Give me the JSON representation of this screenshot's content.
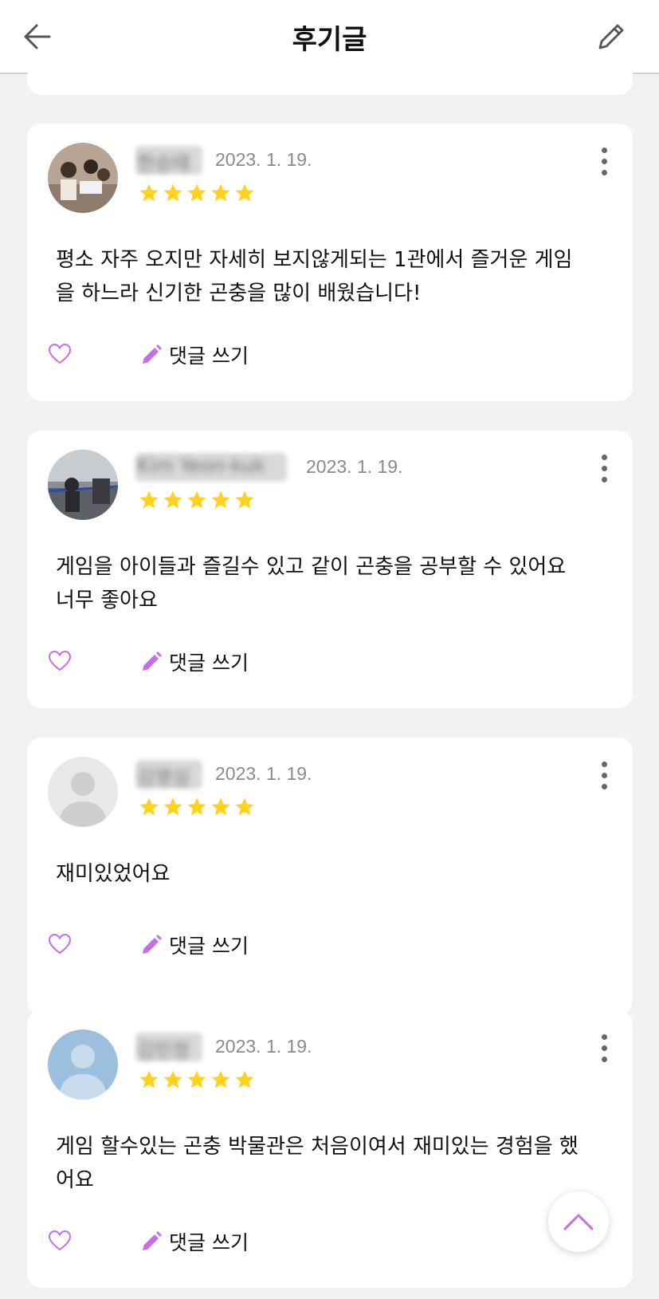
{
  "header": {
    "title": "후기글",
    "back_icon": "back-arrow-icon",
    "edit_icon": "pencil-icon"
  },
  "colors": {
    "star": "#FFD21F",
    "accent": "#C96CE8",
    "header_divider": "#cfcfcf"
  },
  "reviews": [
    {
      "author": "한승태",
      "date": "2023. 1. 19.",
      "rating": 5,
      "text_line1": "평소 자주 오지만 자세히 보지않게되는 1관에서 즐거운 게임",
      "text_line2": "을 하느라 신기한 곤충을 많이 배웠습니다!",
      "comment_label": "댓글 쓰기"
    },
    {
      "author": "Kim Yeon-kuk",
      "date": "2023. 1. 19.",
      "rating": 5,
      "text_line1": "게임을 아이들과 즐길수 있고 같이 곤충을 공부할 수 있어요",
      "text_line2": "너무 좋아요",
      "comment_label": "댓글 쓰기"
    },
    {
      "author": "김영심",
      "date": "2023. 1. 19.",
      "rating": 5,
      "text_line1": "재미있었어요",
      "text_line2": "",
      "comment_label": "댓글 쓰기"
    },
    {
      "author": "김민정",
      "date": "2023. 1. 19.",
      "rating": 5,
      "text_line1": "게임 할수있는 곤충 박물관은 처음이여서 재미있는 경험을 했",
      "text_line2": "어요",
      "comment_label": "댓글 쓰기"
    }
  ]
}
